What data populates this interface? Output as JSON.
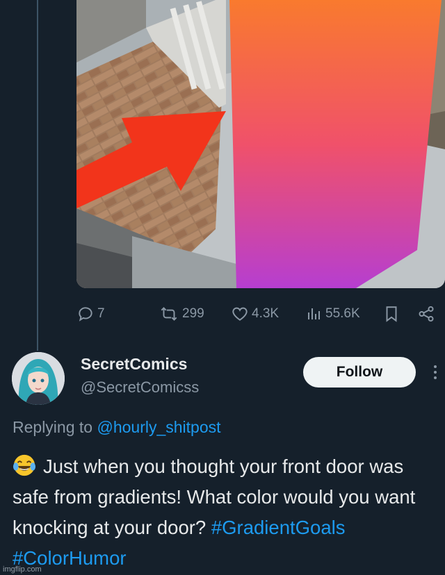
{
  "tweet_actions": {
    "replies": "7",
    "retweets": "299",
    "likes": "4.3K",
    "views": "55.6K"
  },
  "reply": {
    "display_name": "SecretComics",
    "handle": "@SecretComicss",
    "follow_label": "Follow",
    "replying_prefix": "Replying to",
    "replying_to": "@hourly_shitpost",
    "text": "Just when you thought your front door was safe from gradients! What color would you want knocking at your door?",
    "hashtags": [
      "#GradientGoals",
      "#ColorHumor"
    ],
    "emoji": "face-with-tears-of-joy"
  },
  "watermark": "imgflip.com",
  "colors": {
    "background": "#15202b",
    "link": "#1d9bf0",
    "muted": "#8b98a5",
    "gradient_top": "#f97a2e",
    "gradient_bottom": "#b63ed0",
    "arrow": "#f2341b"
  }
}
